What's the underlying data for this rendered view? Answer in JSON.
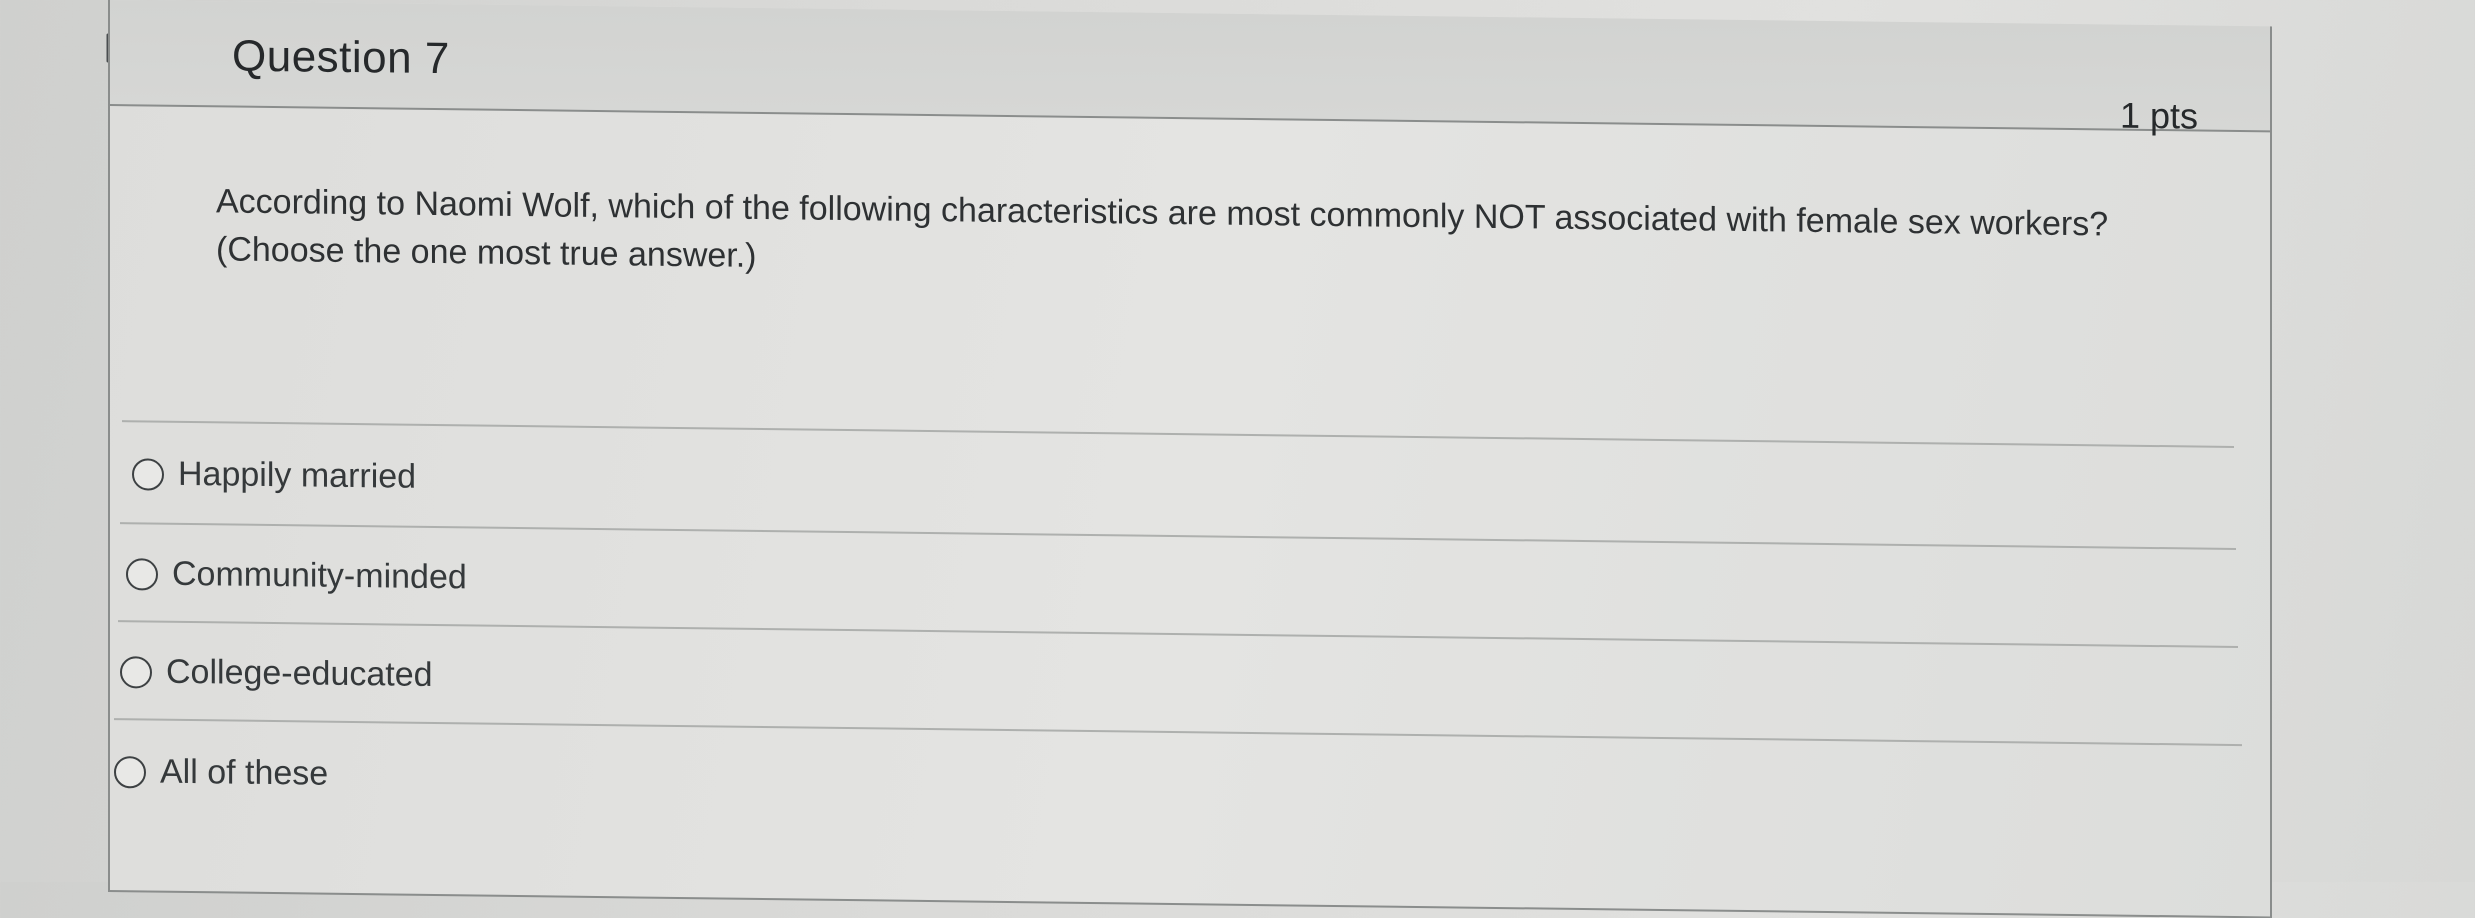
{
  "question": {
    "title": "Question 7",
    "points": "1 pts",
    "text": "According to Naomi Wolf, which of the following characteristics are most commonly NOT associated with female sex workers? (Choose the one most true answer.)"
  },
  "answers": [
    {
      "label": "Happily married"
    },
    {
      "label": "Community-minded"
    },
    {
      "label": "College-educated"
    },
    {
      "label": "All of these"
    }
  ],
  "icons": {
    "flag": "flag-outline-icon",
    "radio": "radio-unchecked-icon"
  },
  "colors": {
    "border": "#8a8d8c",
    "header_bg": "#d2d3d1",
    "text": "#26292b"
  }
}
